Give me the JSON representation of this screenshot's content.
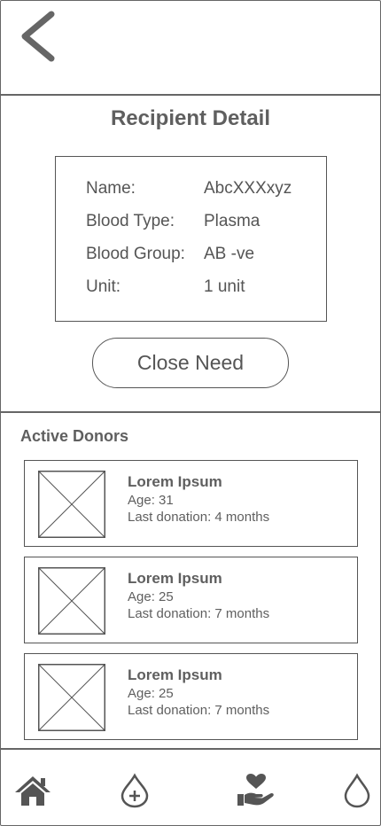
{
  "header": {
    "back_icon": "chevron-left-icon"
  },
  "recipient": {
    "title": "Recipient Detail",
    "fields": [
      {
        "label": "Name:",
        "value": "AbcXXXxyz"
      },
      {
        "label": "Blood Type:",
        "value": "Plasma"
      },
      {
        "label": "Blood Group:",
        "value": "AB -ve"
      },
      {
        "label": "Unit:",
        "value": "1 unit"
      }
    ],
    "close_label": "Close Need"
  },
  "donors": {
    "title": "Active Donors",
    "items": [
      {
        "name": "Lorem Ipsum",
        "age": "Age: 31",
        "last_donation": "Last donation: 4 months"
      },
      {
        "name": "Lorem Ipsum",
        "age": "Age: 25",
        "last_donation": "Last donation: 7 months"
      },
      {
        "name": "Lorem Ipsum",
        "age": "Age: 25",
        "last_donation": "Last donation: 7 months"
      }
    ]
  },
  "nav": {
    "items": [
      {
        "icon": "home-icon"
      },
      {
        "icon": "add-drop-icon"
      },
      {
        "icon": "heart-hand-icon"
      },
      {
        "icon": "drop-icon"
      }
    ]
  },
  "colors": {
    "stroke": "#555555",
    "text": "#5f5f5f",
    "background": "#ffffff"
  }
}
